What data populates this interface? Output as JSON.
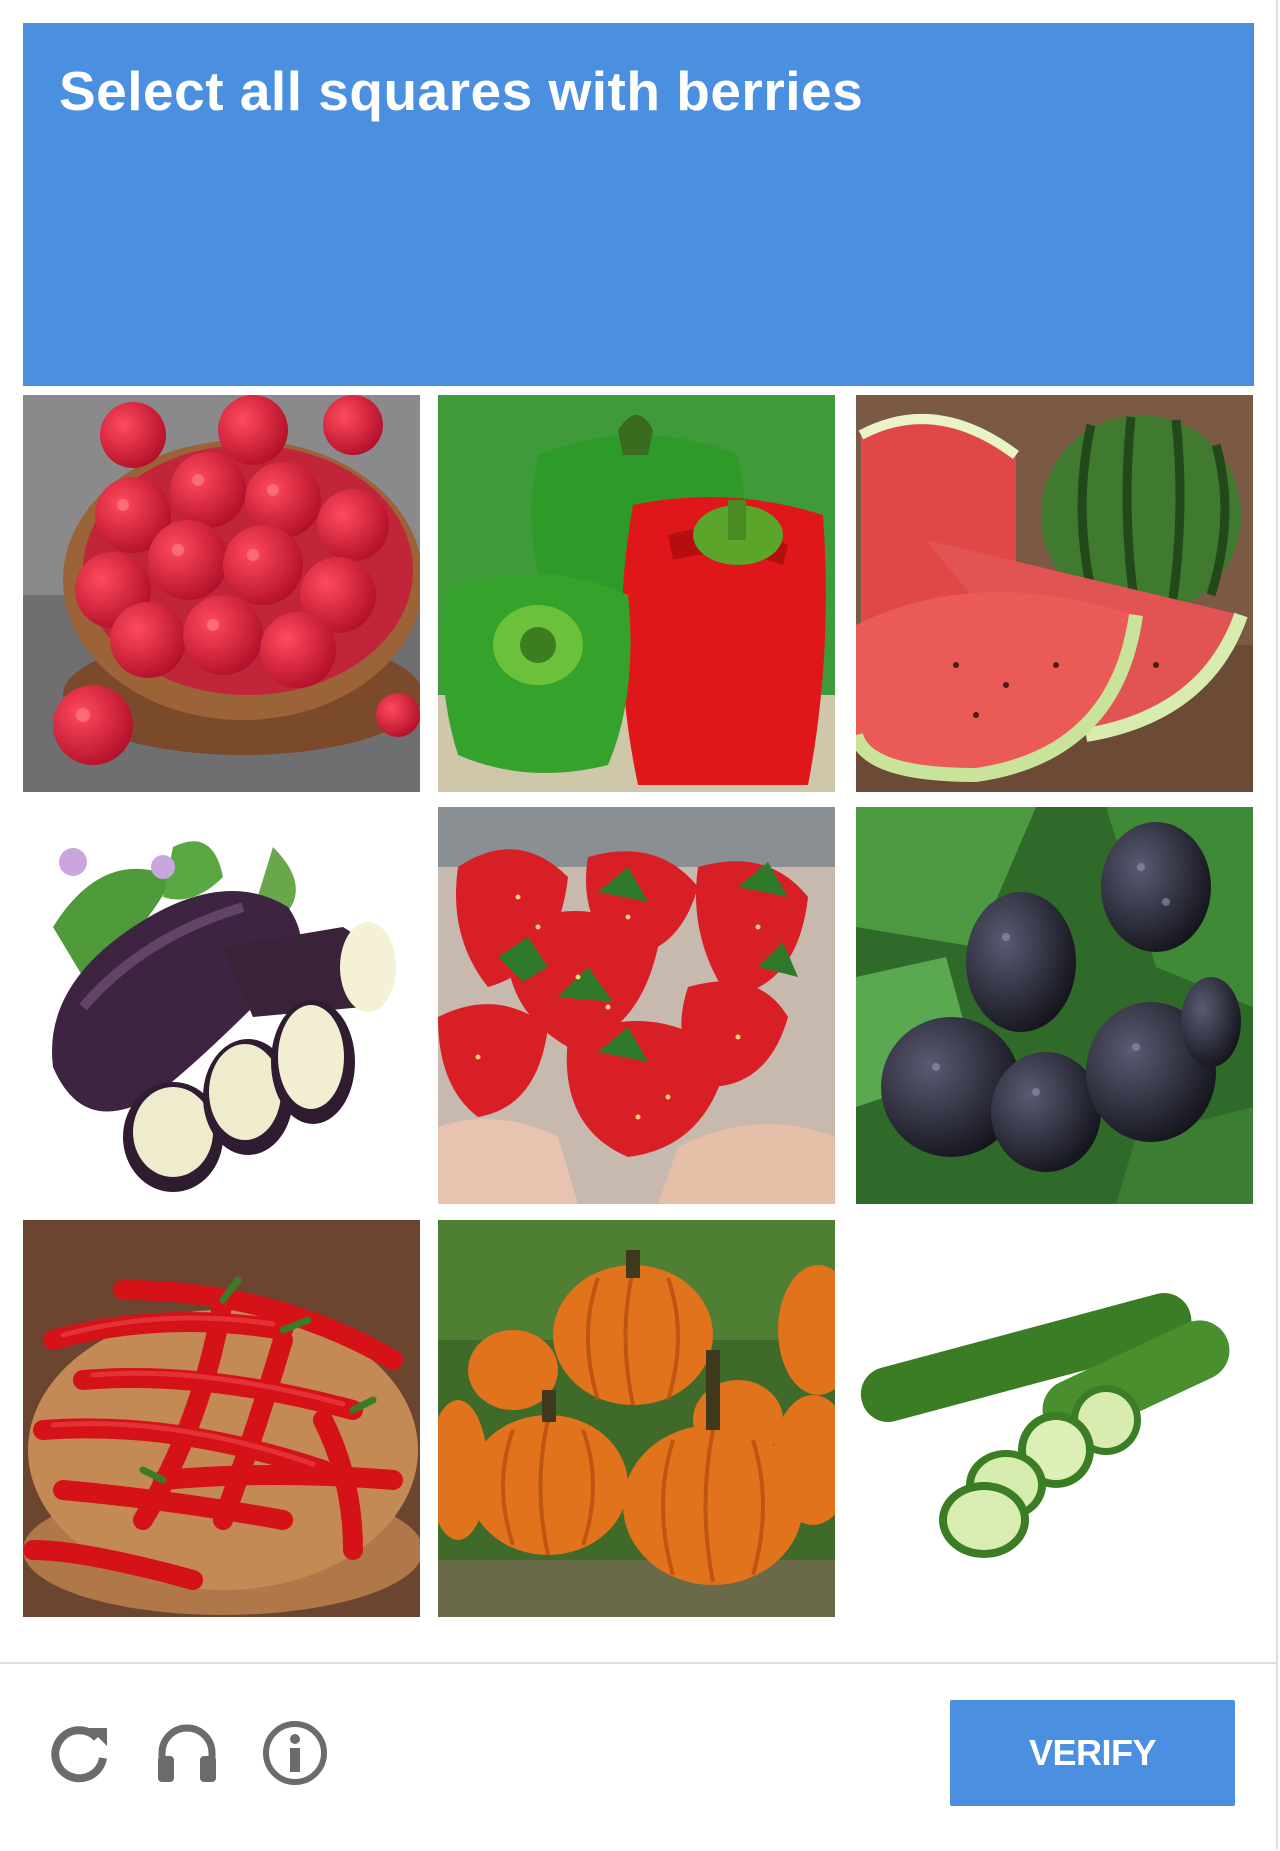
{
  "challenge": {
    "instruction": "Select all squares with berries"
  },
  "tiles": [
    {
      "subject": "raspberries",
      "icon": "raspberries-image"
    },
    {
      "subject": "bell-peppers",
      "icon": "bell-peppers-image"
    },
    {
      "subject": "watermelon",
      "icon": "watermelon-image"
    },
    {
      "subject": "eggplant",
      "icon": "eggplant-image"
    },
    {
      "subject": "strawberries",
      "icon": "strawberries-image"
    },
    {
      "subject": "blackberries",
      "icon": "blackberries-image"
    },
    {
      "subject": "chili-peppers",
      "icon": "chili-peppers-image"
    },
    {
      "subject": "pumpkins",
      "icon": "pumpkins-image"
    },
    {
      "subject": "cucumbers",
      "icon": "cucumbers-image"
    }
  ],
  "footer": {
    "reload_icon": "reload-icon",
    "audio_icon": "headphones-icon",
    "info_icon": "info-icon",
    "verify_label": "VERIFY"
  },
  "colors": {
    "accent": "#4a8fe0",
    "header_text": "#ffffff",
    "icon_gray": "#6b6b6b"
  }
}
